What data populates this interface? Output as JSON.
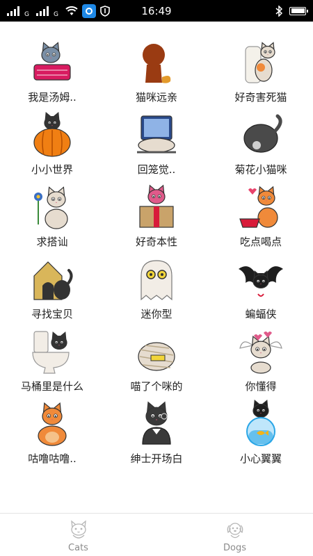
{
  "status_bar": {
    "time": "16:49",
    "signal_label": "G"
  },
  "stickers": [
    {
      "label": "我是汤姆..",
      "icon": "cat-in-basket-icon",
      "color": "#7a8fa6",
      "prop": "#d81b60"
    },
    {
      "label": "猫咪远亲",
      "icon": "lion-icon",
      "color": "#9a3b12",
      "prop": "#e39a2b"
    },
    {
      "label": "好奇害死猫",
      "icon": "cat-toilet-paper-icon",
      "color": "#e6dccf",
      "prop": "#f08a3a"
    },
    {
      "label": "小小世界",
      "icon": "cat-pumpkin-icon",
      "color": "#333333",
      "prop": "#f07f13"
    },
    {
      "label": "回笼觉..",
      "icon": "cat-laptop-icon",
      "color": "#e6dccf",
      "prop": "#2a4a8a"
    },
    {
      "label": "菊花小猫咪",
      "icon": "black-cat-back-icon",
      "color": "#4a4a4a",
      "prop": "#cfcfcf"
    },
    {
      "label": "求搭讪",
      "icon": "cat-flower-icon",
      "color": "#e6dccf",
      "prop": "#3a6fc4"
    },
    {
      "label": "好奇本性",
      "icon": "cat-gift-box-icon",
      "color": "#e05a8a",
      "prop": "#c9a36a"
    },
    {
      "label": "吃点喝点",
      "icon": "cat-food-bowl-icon",
      "color": "#f08a3a",
      "prop": "#d81b3a"
    },
    {
      "label": "寻找宝贝",
      "icon": "cat-doghouse-icon",
      "color": "#333333",
      "prop": "#d9b65a"
    },
    {
      "label": "迷你型",
      "icon": "ghost-cat-icon",
      "color": "#f2ede6",
      "prop": "#333333"
    },
    {
      "label": "蝙蝠侠",
      "icon": "bat-cat-icon",
      "color": "#1e1e1e",
      "prop": "#d81b3a"
    },
    {
      "label": "马桶里是什么",
      "icon": "cat-toilet-icon",
      "color": "#333333",
      "prop": "#f2ede6"
    },
    {
      "label": "喵了个咪的",
      "icon": "mummy-cat-icon",
      "color": "#e6dccf",
      "prop": "#b9a98a"
    },
    {
      "label": "你懂得",
      "icon": "angel-cat-icon",
      "color": "#e6dccf",
      "prop": "#e05a8a"
    },
    {
      "label": "咕噜咕噜..",
      "icon": "orange-cat-icon",
      "color": "#f08a3a",
      "prop": "#f5c28a"
    },
    {
      "label": "绅士开场白",
      "icon": "gentleman-cat-icon",
      "color": "#3a3a3a",
      "prop": "#ffffff"
    },
    {
      "label": "小心翼翼",
      "icon": "cat-fishbowl-icon",
      "color": "#1e1e1e",
      "prop": "#2aa6e6"
    }
  ],
  "bottom_nav": [
    {
      "label": "Cats",
      "icon": "cat-face-icon"
    },
    {
      "label": "Dogs",
      "icon": "dog-face-icon"
    }
  ]
}
